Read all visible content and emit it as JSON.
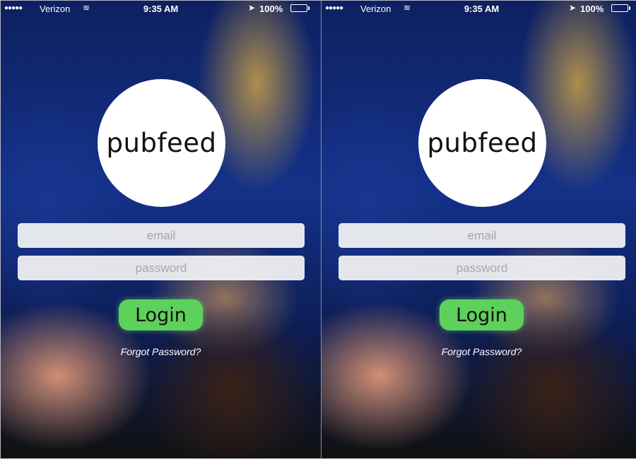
{
  "screens": [
    {
      "status_bar": {
        "signal": "●●●●●",
        "carrier": "Verizon",
        "wifi": "wifi-icon",
        "time": "9:35 AM",
        "location": "location-arrow-icon",
        "battery_percent": "100%",
        "battery_level": 1.0
      },
      "logo": {
        "text": "pubfeed"
      },
      "email": {
        "value": "",
        "placeholder": "email"
      },
      "password": {
        "value": "",
        "placeholder": "password"
      },
      "login_label": "Login",
      "forgot_label": "Forgot Password?"
    },
    {
      "status_bar": {
        "signal": "●●●●●",
        "carrier": "Verizon",
        "wifi": "wifi-icon",
        "time": "9:35 AM",
        "location": "location-arrow-icon",
        "battery_percent": "100%",
        "battery_level": 1.0
      },
      "logo": {
        "text": "pubfeed"
      },
      "email": {
        "value": "",
        "placeholder": "email"
      },
      "password": {
        "value": "",
        "placeholder": "password"
      },
      "login_label": "Login",
      "forgot_label": "Forgot Password?"
    }
  ],
  "colors": {
    "login_button": "#5ed05c",
    "battery": "#5cd34e",
    "field_background": "#ededf1",
    "logo_background": "#ffffff"
  }
}
